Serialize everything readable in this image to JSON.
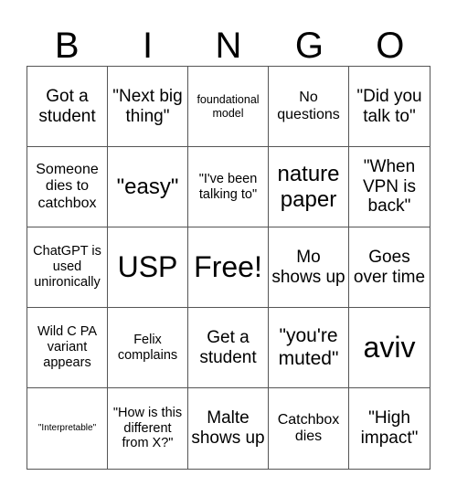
{
  "header": [
    "B",
    "I",
    "N",
    "G",
    "O"
  ],
  "cells": [
    "Got a student",
    "\"Next big thing\"",
    "foundational model",
    "No questions",
    "\"Did you talk to\"",
    "Someone dies to catchbox",
    "\"easy\"",
    "\"I've been talking to\"",
    "nature paper",
    "\"When VPN is back\"",
    "ChatGPT is used unironically",
    "USP",
    "Free!",
    "Mo shows up",
    "Goes over time",
    "Wild C PA variant appears",
    "Felix complains",
    "Get a student",
    "\"you're muted\"",
    "aviv",
    "\"Interpretable\"",
    "\"How is this different from X?\"",
    "Malte shows up",
    "Catchbox dies",
    "\"High impact\""
  ]
}
